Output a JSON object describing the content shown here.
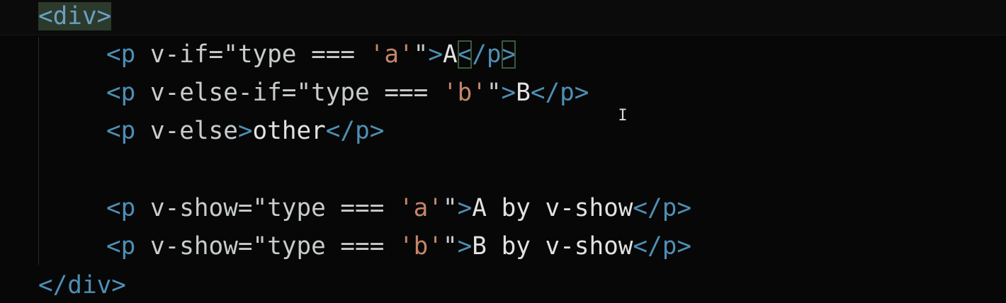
{
  "editor": {
    "colors": {
      "background": "#070707",
      "tag": "#4e8fb5",
      "attribute": "#c9cccc",
      "string_literal": "#c4866a",
      "text": "#e2e2e2"
    },
    "lines": [
      {
        "open_tag": "<div>"
      },
      {
        "tag_open": "<p",
        "attr": " v-if=\"type === ",
        "literal": "'a'",
        "attr_end": "\"",
        "gt": ">",
        "content": "A",
        "close_lt": "<",
        "close_rest": "/p",
        "close_gt": ">"
      },
      {
        "tag_open": "<p",
        "attr": " v-else-if=\"type === ",
        "literal": "'b'",
        "attr_end": "\"",
        "gt": ">",
        "content": "B",
        "close_tag": "</p>"
      },
      {
        "tag_open": "<p",
        "attr": " v-else",
        "gt": ">",
        "content": "other",
        "close_tag": "</p>"
      },
      {
        "tag_open": "<p",
        "attr": " v-show=\"type === ",
        "literal": "'a'",
        "attr_end": "\"",
        "gt": ">",
        "content": "A by v-show",
        "close_tag": "</p>"
      },
      {
        "tag_open": "<p",
        "attr": " v-show=\"type === ",
        "literal": "'b'",
        "attr_end": "\"",
        "gt": ">",
        "content": "B by v-show",
        "close_tag": "</p>"
      },
      {
        "close_div": "</div>"
      }
    ],
    "cursor_icon": "text-cursor-icon",
    "cursor_glyph": "I"
  }
}
